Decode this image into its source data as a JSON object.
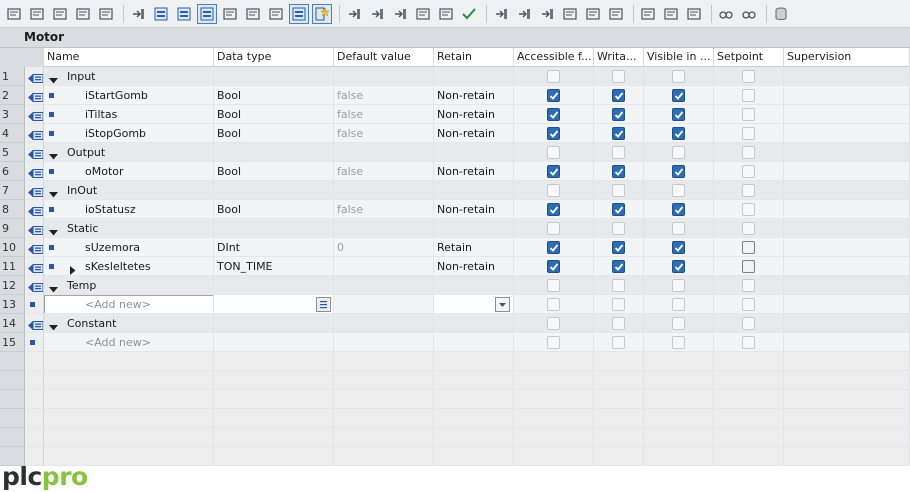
{
  "toolbar": {
    "groups": [
      [
        "insert-row-icon",
        "delete-row-icon",
        "insert-below-icon",
        "add-row-icon",
        "clear-icon"
      ],
      [
        "indent-icon",
        "expand-all-icon",
        "collapse-all-icon",
        "comment-icon",
        "monitor-icon",
        "snapshot-icon",
        "load-icon",
        "show-list-icon",
        "favorites-icon"
      ],
      [
        "jump-icon",
        "jump-back-icon",
        "goto-icon",
        "reference-icon",
        "cross-ref-icon",
        "check-icon"
      ],
      [
        "jump-left-icon",
        "indent-right-icon",
        "indent-left-icon",
        "split-icon",
        "align-icon",
        "sort-icon"
      ],
      [
        "bookmark-icon",
        "bookmark-next-icon",
        "bookmark-prev-icon"
      ],
      [
        "watch-icon",
        "glasses-icon"
      ],
      [
        "database-icon"
      ]
    ],
    "active": [
      "comment-icon",
      "favorites-icon",
      "show-list-icon"
    ]
  },
  "title": "Motor",
  "columns": [
    "Name",
    "Data type",
    "Default value",
    "Retain",
    "Accessible f...",
    "Writa...",
    "Visible in ...",
    "Setpoint",
    "Supervision"
  ],
  "rows": [
    {
      "num": "1",
      "kind": "section",
      "name": "Input",
      "acc": false,
      "wr": false,
      "vis": false,
      "sp": "off"
    },
    {
      "num": "2",
      "kind": "var",
      "name": "iStartGomb",
      "type": "Bool",
      "def": "false",
      "retain": "Non-retain",
      "acc": true,
      "wr": true,
      "vis": true,
      "sp": "off"
    },
    {
      "num": "3",
      "kind": "var",
      "name": "iTiltas",
      "type": "Bool",
      "def": "false",
      "retain": "Non-retain",
      "acc": true,
      "wr": true,
      "vis": true,
      "sp": "off"
    },
    {
      "num": "4",
      "kind": "var",
      "name": "iStopGomb",
      "type": "Bool",
      "def": "false",
      "retain": "Non-retain",
      "acc": true,
      "wr": true,
      "vis": true,
      "sp": "off"
    },
    {
      "num": "5",
      "kind": "section",
      "name": "Output",
      "acc": false,
      "wr": false,
      "vis": false,
      "sp": "off"
    },
    {
      "num": "6",
      "kind": "var",
      "name": "oMotor",
      "type": "Bool",
      "def": "false",
      "retain": "Non-retain",
      "acc": true,
      "wr": true,
      "vis": true,
      "sp": "off"
    },
    {
      "num": "7",
      "kind": "section",
      "name": "InOut",
      "acc": false,
      "wr": false,
      "vis": false,
      "sp": "off"
    },
    {
      "num": "8",
      "kind": "var",
      "name": "ioStatusz",
      "type": "Bool",
      "def": "false",
      "retain": "Non-retain",
      "acc": true,
      "wr": true,
      "vis": true,
      "sp": "off"
    },
    {
      "num": "9",
      "kind": "section",
      "name": "Static",
      "acc": false,
      "wr": false,
      "vis": false,
      "sp": "off"
    },
    {
      "num": "10",
      "kind": "var",
      "name": "sUzemora",
      "type": "DInt",
      "def": "0",
      "retain": "Retain",
      "acc": true,
      "wr": true,
      "vis": true,
      "sp": "dark"
    },
    {
      "num": "11",
      "kind": "var",
      "expandable": true,
      "name": "sKesleltetes",
      "type": "TON_TIME",
      "def": "",
      "retain": "Non-retain",
      "acc": true,
      "wr": true,
      "vis": true,
      "sp": "dark"
    },
    {
      "num": "12",
      "kind": "section",
      "name": "Temp",
      "acc": false,
      "wr": false,
      "vis": false,
      "sp": "off"
    },
    {
      "num": "13",
      "kind": "new",
      "name": "<Add new>",
      "editing": true,
      "acc": false,
      "wr": false,
      "vis": false,
      "sp": "off"
    },
    {
      "num": "14",
      "kind": "section",
      "name": "Constant",
      "acc": false,
      "wr": false,
      "vis": false,
      "sp": "off"
    },
    {
      "num": "15",
      "kind": "new",
      "name": "<Add new>",
      "editing": false,
      "acc": false,
      "wr": false,
      "vis": false,
      "sp": "off"
    }
  ],
  "empty_rows": 6,
  "logo": {
    "part1": "plc",
    "part2": "pro"
  },
  "colors": {
    "accent": "#2c6db5",
    "logo_green": "#86c440",
    "logo_dark": "#2f2f2f"
  }
}
